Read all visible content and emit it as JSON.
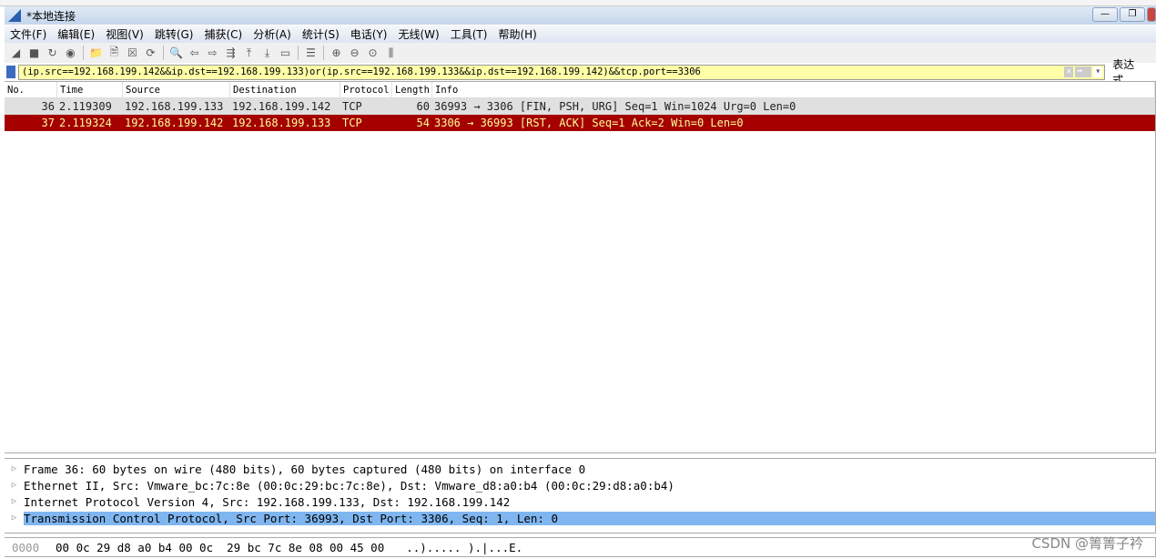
{
  "window": {
    "title": "*本地连接",
    "minimize": "—",
    "restore": "❐"
  },
  "menu": [
    "文件(F)",
    "编辑(E)",
    "视图(V)",
    "跳转(G)",
    "捕获(C)",
    "分析(A)",
    "统计(S)",
    "电话(Y)",
    "无线(W)",
    "工具(T)",
    "帮助(H)"
  ],
  "toolbar": [
    {
      "name": "start-capture-icon",
      "glyph": "◢"
    },
    {
      "name": "stop-capture-icon",
      "glyph": "■"
    },
    {
      "name": "restart-capture-icon",
      "glyph": "↻"
    },
    {
      "name": "capture-options-icon",
      "glyph": "◉"
    },
    {
      "sep": true
    },
    {
      "name": "open-file-icon",
      "glyph": "📁"
    },
    {
      "name": "save-file-icon",
      "glyph": "🗎"
    },
    {
      "name": "close-file-icon",
      "glyph": "☒"
    },
    {
      "name": "reload-icon",
      "glyph": "⟳"
    },
    {
      "sep": true
    },
    {
      "name": "find-packet-icon",
      "glyph": "🔍"
    },
    {
      "name": "go-back-icon",
      "glyph": "⇦"
    },
    {
      "name": "go-forward-icon",
      "glyph": "⇨"
    },
    {
      "name": "go-to-packet-icon",
      "glyph": "⇶"
    },
    {
      "name": "first-packet-icon",
      "glyph": "⤒"
    },
    {
      "name": "last-packet-icon",
      "glyph": "⤓"
    },
    {
      "name": "autoscroll-icon",
      "glyph": "▭"
    },
    {
      "sep": true
    },
    {
      "name": "colorize-icon",
      "glyph": "☰"
    },
    {
      "sep": true
    },
    {
      "name": "zoom-in-icon",
      "glyph": "⊕"
    },
    {
      "name": "zoom-out-icon",
      "glyph": "⊖"
    },
    {
      "name": "zoom-normal-icon",
      "glyph": "⊙"
    },
    {
      "name": "resize-columns-icon",
      "glyph": "⫼"
    }
  ],
  "filter": {
    "value": "(ip.src==192.168.199.142&&ip.dst==192.168.199.133)or(ip.src==192.168.199.133&&ip.dst==192.168.199.142)&&tcp.port==3306",
    "clear": "✕",
    "apply": "➡",
    "dropdown": "▾",
    "expression": "表达式…"
  },
  "columns": [
    "No.",
    "Time",
    "Source",
    "Destination",
    "Protocol",
    "Length",
    "Info"
  ],
  "packets": [
    {
      "no": "36",
      "time": "2.119309",
      "src": "192.168.199.133",
      "dst": "192.168.199.142",
      "proto": "TCP",
      "len": "60",
      "info": "36993 → 3306 [FIN, PSH, URG] Seq=1 Win=1024 Urg=0 Len=0"
    },
    {
      "no": "37",
      "time": "2.119324",
      "src": "192.168.199.142",
      "dst": "192.168.199.133",
      "proto": "TCP",
      "len": "54",
      "info": "3306 → 36993 [RST, ACK] Seq=1 Ack=2 Win=0 Len=0"
    }
  ],
  "details": [
    "Frame 36: 60 bytes on wire (480 bits), 60 bytes captured (480 bits) on interface 0",
    "Ethernet II, Src: Vmware_bc:7c:8e (00:0c:29:bc:7c:8e), Dst: Vmware_d8:a0:b4 (00:0c:29:d8:a0:b4)",
    "Internet Protocol Version 4, Src: 192.168.199.133, Dst: 192.168.199.142",
    "Transmission Control Protocol, Src Port: 36993, Dst Port: 3306, Seq: 1, Len: 0"
  ],
  "bytes": {
    "offset": "0000",
    "hex": "00 0c 29 d8 a0 b4 00 0c  29 bc 7c 8e 08 00 45 00",
    "ascii": "..)..... ).|...E."
  },
  "watermark": "CSDN @箐箐子衿",
  "colors": {
    "selected_row": "#a40000",
    "selected_text": "#fffc9c",
    "filter_bg": "#ffffa8",
    "detail_highlight": "#80b6f0"
  }
}
